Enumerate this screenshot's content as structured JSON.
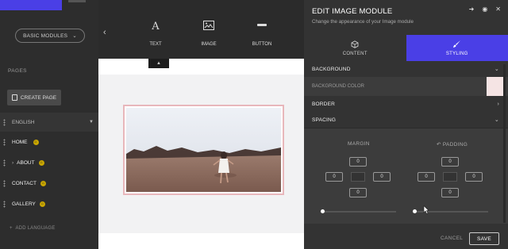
{
  "sidebar": {
    "modules_dropdown": "BASIC MODULES",
    "pages_label": "PAGES",
    "create_page": "CREATE PAGE",
    "language": "ENGLISH",
    "pages": [
      {
        "label": "HOME",
        "has_home_icon": true
      },
      {
        "label": "ABOUT",
        "has_home_icon": false,
        "expandable": true
      },
      {
        "label": "CONTACT",
        "has_home_icon": false
      },
      {
        "label": "GALLERY",
        "has_home_icon": false
      }
    ],
    "add_language": "ADD LANGUAGE"
  },
  "toolbar": {
    "tools": [
      {
        "label": "TEXT",
        "icon": "text-icon"
      },
      {
        "label": "IMAGE",
        "icon": "image-icon"
      },
      {
        "label": "BUTTON",
        "icon": "button-icon"
      }
    ]
  },
  "panel": {
    "title": "EDIT IMAGE MODULE",
    "subtitle": "Change the appearance of your Image module",
    "tabs": [
      {
        "label": "CONTENT",
        "icon": "cube-icon",
        "active": false
      },
      {
        "label": "STYLING",
        "icon": "brush-icon",
        "active": true
      }
    ],
    "sections": {
      "background": "BACKGROUND",
      "background_color": "BACKGROUND COLOR",
      "border": "BORDER",
      "spacing": "SPACING"
    },
    "margin": {
      "label": "MARGIN",
      "top": "0",
      "left": "0",
      "right": "0",
      "bottom": "0",
      "slider": 0
    },
    "padding": {
      "label": "PADDING",
      "top": "0",
      "left": "0",
      "right": "0",
      "bottom": "0",
      "slider": 0
    },
    "cancel": "CANCEL",
    "save": "SAVE"
  },
  "colors": {
    "accent": "#4a3fe6",
    "panel_bg": "#333333",
    "image_border": "#e8b7bb",
    "bg_swatch": "#f5e4e4",
    "home_badge": "#c9a600"
  }
}
